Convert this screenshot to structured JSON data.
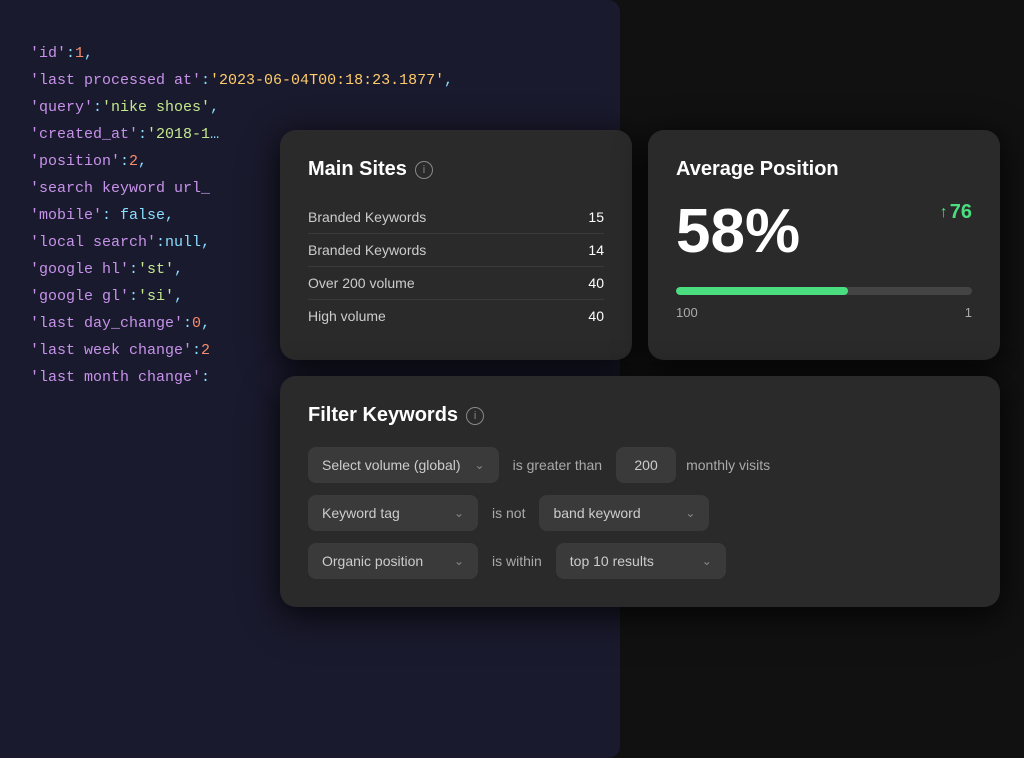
{
  "code": {
    "lines": [
      {
        "key": "'id'",
        "punc": ":",
        "val": "1",
        "type": "num",
        "trail": ","
      },
      {
        "key": "'last processed at'",
        "punc": ":",
        "val": "'2023-06-04T00:18:23.1877'",
        "type": "date",
        "trail": ","
      },
      {
        "key": "'query'",
        "punc": ":",
        "val": "'nike shoes'",
        "type": "str",
        "trail": ","
      },
      {
        "key": "'created_at'",
        "punc": ":",
        "val": "'2018-1…",
        "type": "str",
        "trail": ""
      },
      {
        "key": "'position'",
        "punc": ":",
        "val": "2",
        "type": "num",
        "trail": ","
      },
      {
        "key": "'search keyword url_",
        "punc": "",
        "val": "",
        "type": "plain",
        "trail": ""
      },
      {
        "key": "'mobile'",
        "punc": ":",
        "val": "false",
        "type": "kw",
        "trail": ","
      },
      {
        "key": "'local search'",
        "punc": ":",
        "val": "null",
        "type": "kw",
        "trail": ","
      },
      {
        "key": "'google hl'",
        "punc": ":",
        "val": "'st'",
        "type": "str",
        "trail": ","
      },
      {
        "key": "'google gl'",
        "punc": ":",
        "val": "'si'",
        "type": "str",
        "trail": ","
      },
      {
        "key": "'last day_change'",
        "punc": ":",
        "val": "0",
        "type": "num",
        "trail": ","
      },
      {
        "key": "'last week change'",
        "punc": ":",
        "val": "2",
        "type": "num",
        "trail": ""
      },
      {
        "key": "'last month change'",
        "punc": ":",
        "val": "",
        "type": "plain",
        "trail": ""
      }
    ]
  },
  "main_sites": {
    "title": "Main Sites",
    "rows": [
      {
        "label": "Branded Keywords",
        "count": "15"
      },
      {
        "label": "Branded Keywords",
        "count": "14"
      },
      {
        "label": "Over 200 volume",
        "count": "40"
      },
      {
        "label": "High volume",
        "count": "40"
      }
    ]
  },
  "avg_position": {
    "title": "Average Position",
    "percentage": "58%",
    "trend_value": "76",
    "progress_fill": "58",
    "progress_max": "100",
    "progress_min": "1",
    "label_left": "100",
    "label_right": "1"
  },
  "filter_keywords": {
    "title": "Filter Keywords",
    "rows": [
      {
        "select_label": "Select volume (global)",
        "operator": "is greater than",
        "value": "200",
        "unit": "monthly visits",
        "has_value_dropdown": false
      },
      {
        "select_label": "Keyword tag",
        "operator": "is not",
        "value": "",
        "unit": "",
        "value_dropdown": "band keyword",
        "has_value_dropdown": true
      },
      {
        "select_label": "Organic position",
        "operator": "is within",
        "value": "",
        "unit": "",
        "value_dropdown": "top 10 results",
        "has_value_dropdown": true
      }
    ]
  },
  "icons": {
    "info": "ⓘ",
    "chevron_down": "⌄",
    "trend_up": "↑"
  }
}
